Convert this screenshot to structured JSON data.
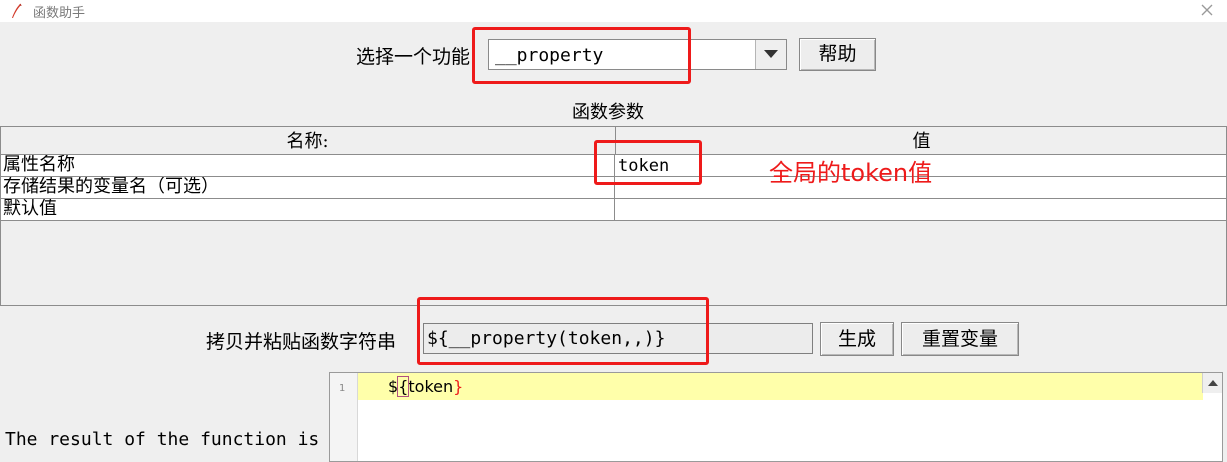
{
  "window": {
    "title": "函数助手"
  },
  "function_selector": {
    "label": "选择一个功能",
    "selected": "__property",
    "help_button": "帮助"
  },
  "params": {
    "section_title": "函数参数",
    "header_name": "名称:",
    "header_value": "值",
    "rows": [
      {
        "name": "属性名称",
        "value": "token"
      },
      {
        "name": "存储结果的变量名（可选）",
        "value": ""
      },
      {
        "name": "默认值",
        "value": ""
      }
    ]
  },
  "annotation": {
    "text": "全局的token值",
    "color": "#ee1a1a"
  },
  "copy": {
    "label": "拷贝并粘贴函数字符串",
    "value": "${__property(token,,)}",
    "generate_button": "生成",
    "reset_button": "重置变量"
  },
  "result": {
    "label": "The result of the function is",
    "line_number": "1",
    "code_prefix": "$",
    "code_open": "{",
    "code_body": "token",
    "code_close": "}"
  }
}
